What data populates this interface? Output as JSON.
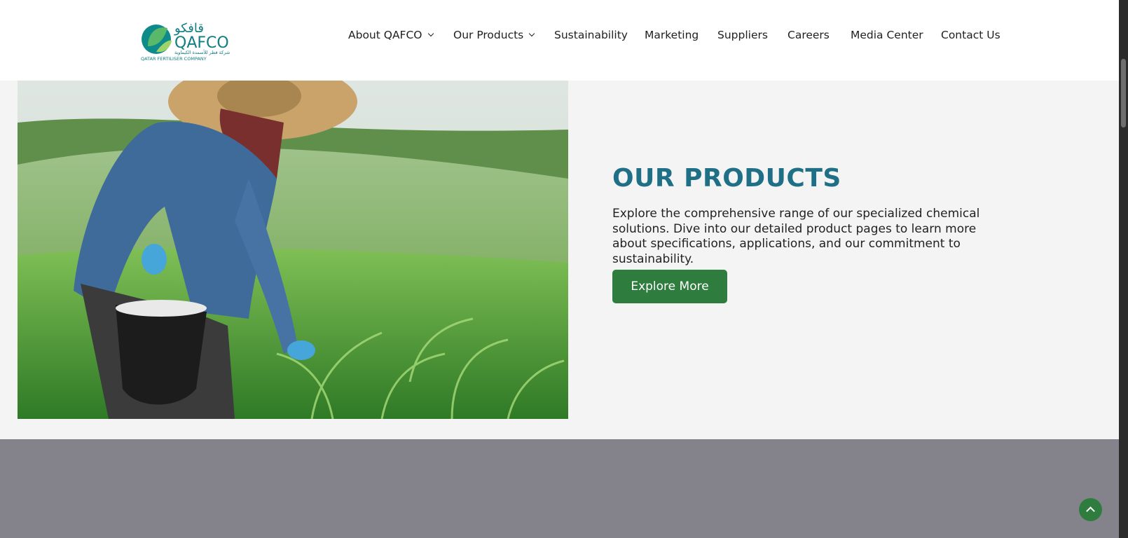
{
  "header": {
    "logo": {
      "arabic": "قافكو",
      "wordmark": "QAFCO",
      "arabic_sub": "شركة قطر للأسمدة الكيماوية",
      "tagline": "QATAR FERTILISER COMPANY"
    },
    "nav": [
      {
        "label": "About QAFCO",
        "dropdown": true
      },
      {
        "label": "Our Products",
        "dropdown": true
      },
      {
        "label": "Sustainability",
        "dropdown": false
      },
      {
        "label": "Marketing",
        "dropdown": false
      },
      {
        "label": "Suppliers",
        "dropdown": false
      },
      {
        "label": "Careers",
        "dropdown": false
      },
      {
        "label": "Media Center",
        "dropdown": false
      },
      {
        "label": "Contact Us",
        "dropdown": false
      }
    ]
  },
  "products": {
    "title": "OUR PRODUCTS",
    "description": "Explore the comprehensive range of our specialized chemical solutions. Dive into our detailed product pages to learn more about specifications, applications, and our commitment to sustainability.",
    "button_label": "Explore More"
  },
  "icons": {
    "back_to_top": "chevron-up-icon",
    "nav_dropdown": "chevron-down-icon"
  },
  "colors": {
    "title": "#1f6f86",
    "button": "#2e7d3e",
    "footer_band": "#84838b",
    "background": "#f4f4f4"
  }
}
